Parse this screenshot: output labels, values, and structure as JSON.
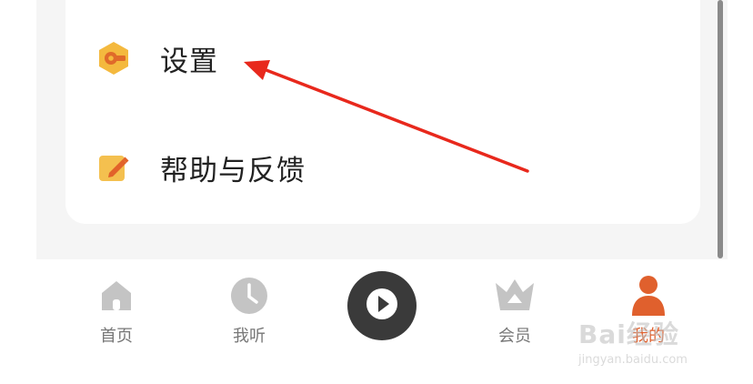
{
  "menu": {
    "items": [
      {
        "label": "设置",
        "icon": "settings-hex-icon"
      },
      {
        "label": "帮助与反馈",
        "icon": "edit-note-icon"
      }
    ]
  },
  "tabbar": {
    "tabs": [
      {
        "label": "首页",
        "icon": "home-icon",
        "active": false
      },
      {
        "label": "我听",
        "icon": "clock-icon",
        "active": false
      },
      {
        "label": "",
        "icon": "play-icon",
        "active": false
      },
      {
        "label": "会员",
        "icon": "crown-icon",
        "active": false
      },
      {
        "label": "我的",
        "icon": "user-icon",
        "active": true
      }
    ]
  },
  "watermark": {
    "brand": "Bai经验",
    "url": "jingyan.baidu.com"
  },
  "colors": {
    "accent": "#e0602d",
    "icon_yellow": "#f4b93e",
    "annotation_arrow": "#e8281c",
    "inactive": "#c4c4c4"
  }
}
